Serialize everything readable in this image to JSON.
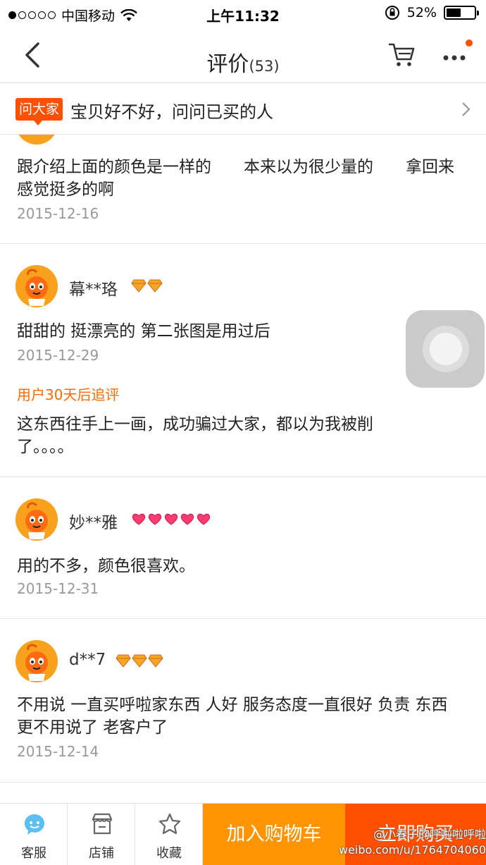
{
  "status_bar": {
    "carrier": "中国移动",
    "time": "上午11:32",
    "battery": "52%",
    "battery_level": 0.52
  },
  "nav": {
    "title": "评价",
    "count": "(53)"
  },
  "ask_banner": {
    "tag": "问大家",
    "text": "宝贝好不好，问问已买的人"
  },
  "reviews": [
    {
      "text": "跟介绍上面的颜色是一样的　　本来以为很少量的　　拿回来感觉挺多的啊",
      "date": "2015-12-16"
    },
    {
      "user": "幕**珞",
      "badge_type": "diamond",
      "badge_count": 2,
      "text": "甜甜的 挺漂亮的 第二张图是用过后",
      "date": "2015-12-29",
      "followup_label": "用户30天后追评",
      "followup_text": "这东西往手上一画，成功骗过大家，都以为我被削了。。。。"
    },
    {
      "user": "妙**雅",
      "badge_type": "heart",
      "badge_count": 5,
      "text": "用的不多，颜色很喜欢。",
      "date": "2015-12-31"
    },
    {
      "user": "d**7",
      "badge_type": "diamond",
      "badge_count": 3,
      "text": "不用说 一直买呼啦家东西 人好 服务态度一直很好 负责 东西更不用说了 老客户了",
      "date": "2015-12-14"
    }
  ],
  "tabbar": {
    "service": "客服",
    "shop": "店铺",
    "favorite": "收藏",
    "add_to_cart": "加入购物车",
    "buy_now": "立即购买"
  },
  "watermark": {
    "line1": "@小春子的呼啦啦呼啦",
    "line2": "weibo.com/u/1764704060"
  },
  "colors": {
    "accent": "#ff5000",
    "cart_button": "#ff9402",
    "followup": "#ff6a00"
  }
}
